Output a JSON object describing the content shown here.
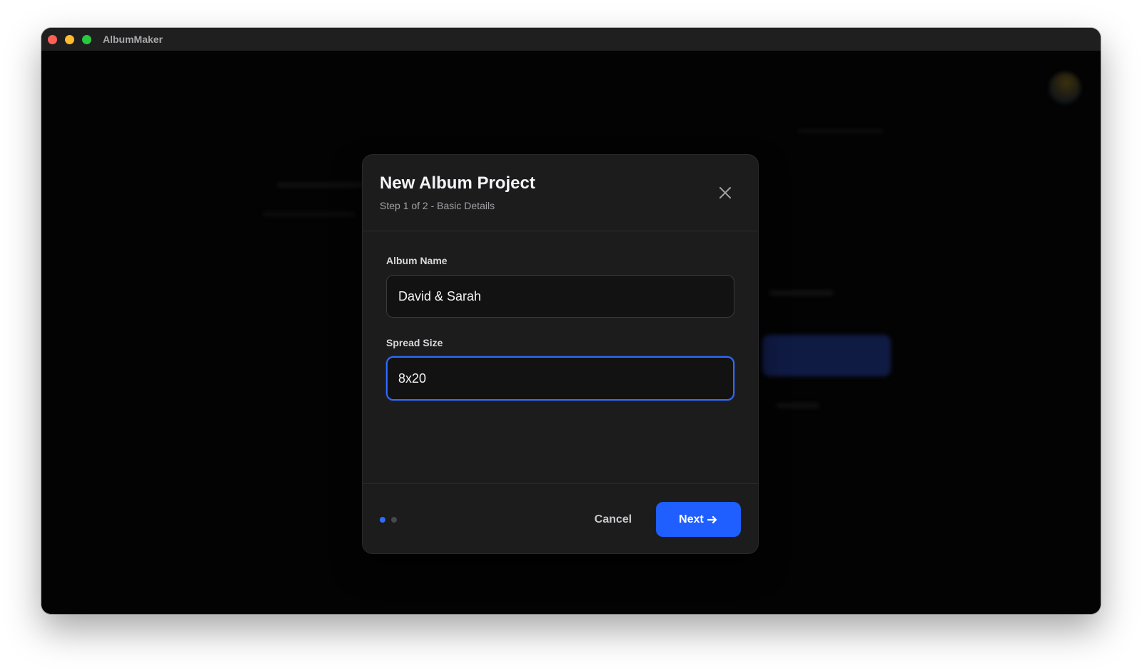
{
  "window": {
    "app_title": "AlbumMaker"
  },
  "modal": {
    "title": "New Album Project",
    "subtitle": "Step 1 of 2 - Basic Details",
    "fields": {
      "album_name": {
        "label": "Album Name",
        "value": "David & Sarah"
      },
      "spread_size": {
        "label": "Spread Size",
        "value": "8x20"
      }
    },
    "steps": {
      "current": 1,
      "total": 2
    },
    "buttons": {
      "cancel_label": "Cancel",
      "next_label": "Next",
      "next_icon": "arrow-right-icon",
      "close_icon": "close-icon"
    }
  },
  "colors": {
    "accent": "#1f5eff",
    "focus_ring": "#2f6bff",
    "modal_bg": "#1c1c1d",
    "window_bg": "#030303"
  }
}
